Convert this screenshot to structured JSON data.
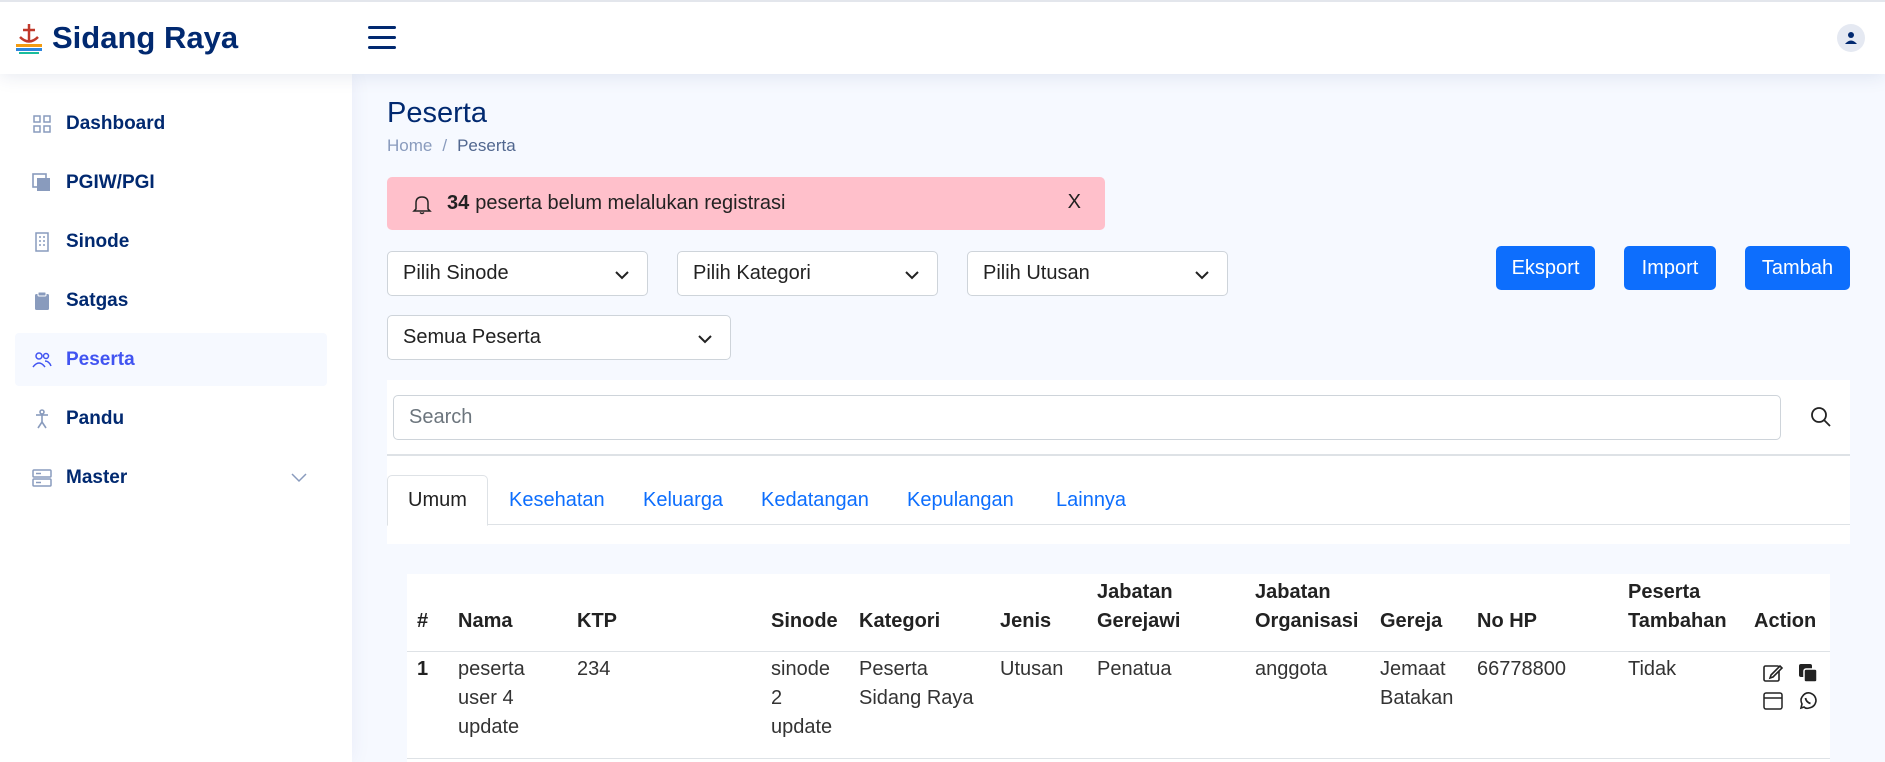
{
  "header": {
    "app_title": "Sidang Raya"
  },
  "sidebar": {
    "items": [
      {
        "label": "Dashboard",
        "icon": "grid-icon"
      },
      {
        "label": "PGIW/PGI",
        "icon": "stack-icon"
      },
      {
        "label": "Sinode",
        "icon": "building-icon"
      },
      {
        "label": "Satgas",
        "icon": "clipboard-icon"
      },
      {
        "label": "Peserta",
        "icon": "people-icon",
        "active": true
      },
      {
        "label": "Pandu",
        "icon": "person-icon"
      },
      {
        "label": "Master",
        "icon": "server-icon",
        "expandable": true
      }
    ]
  },
  "page": {
    "title": "Peserta",
    "breadcrumb": {
      "home": "Home",
      "separator": "/",
      "current": "Peserta"
    }
  },
  "alert": {
    "count": "34",
    "message": "peserta belum melalukan registrasi",
    "close": "X"
  },
  "filters": {
    "sinode": "Pilih Sinode",
    "kategori": "Pilih Kategori",
    "utusan": "Pilih Utusan",
    "peserta": "Semua Peserta"
  },
  "buttons": {
    "export": "Eksport",
    "import": "Import",
    "add": "Tambah"
  },
  "search": {
    "placeholder": "Search"
  },
  "tabs": [
    "Umum",
    "Kesehatan",
    "Keluarga",
    "Kedatangan",
    "Kepulangan",
    "Lainnya"
  ],
  "table": {
    "headers": {
      "num": "#",
      "nama": "Nama",
      "ktp": "KTP",
      "sinode": "Sinode",
      "kategori": "Kategori",
      "jenis": "Jenis",
      "jabatan_gerejawi_1": "Jabatan",
      "jabatan_gerejawi_2": "Gerejawi",
      "jabatan_organisasi_1": "Jabatan",
      "jabatan_organisasi_2": "Organisasi",
      "gereja": "Gereja",
      "nohp": "No HP",
      "peserta_tambahan_1": "Peserta",
      "peserta_tambahan_2": "Tambahan",
      "action": "Action"
    },
    "rows": [
      {
        "num": "1",
        "nama": [
          "peserta",
          "user 4",
          "update"
        ],
        "ktp": "234",
        "sinode": [
          "sinode",
          "2",
          "update"
        ],
        "kategori": [
          "Peserta",
          "Sidang Raya"
        ],
        "jenis": "Utusan",
        "jabatan_gerejawi": "Penatua",
        "jabatan_organisasi": "anggota",
        "gereja": [
          "Jemaat",
          "Batakan"
        ],
        "nohp": "66778800",
        "peserta_tambahan": "Tidak"
      }
    ]
  },
  "colors": {
    "primary": "#0d6efd",
    "brand": "#012970",
    "alert_bg": "#ffc0cb",
    "active_nav": "#4154f1"
  }
}
